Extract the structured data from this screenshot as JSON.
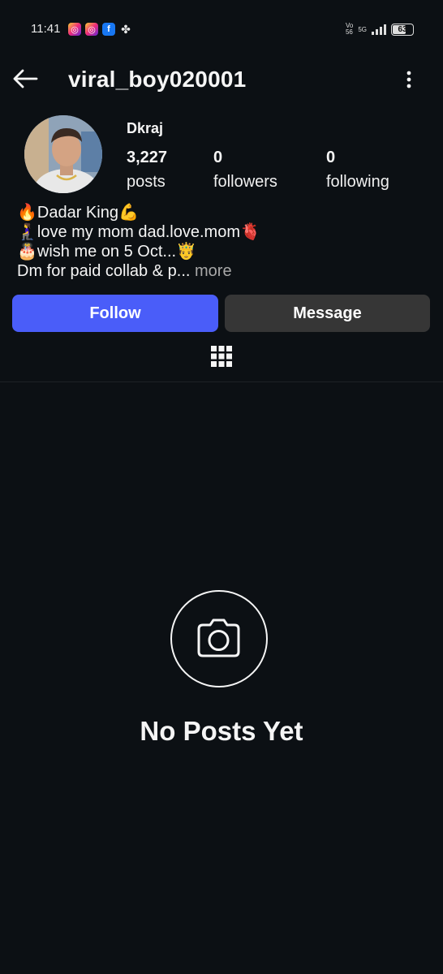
{
  "status_bar": {
    "time": "11:41",
    "volte_top": "Vo",
    "volte_bottom": "56",
    "network": "5G",
    "battery": "63"
  },
  "header": {
    "username": "viral_boy020001",
    "back_icon": "arrow-left-icon",
    "more_icon": "vertical-dots-icon"
  },
  "profile": {
    "display_name": "Dkraj",
    "stats": [
      {
        "value": "3,227",
        "label": "posts"
      },
      {
        "value": "0",
        "label": "followers"
      },
      {
        "value": "0",
        "label": "following"
      }
    ],
    "bio": [
      "🔥Dadar King💪",
      "🧎‍♀️love my mom dad.love.mom🫀",
      "🎂wish me on 5 Oct...🤴",
      "Dm for paid collab & p..."
    ],
    "bio_more": "more"
  },
  "actions": {
    "follow_label": "Follow",
    "message_label": "Message"
  },
  "empty_state": {
    "title": "No Posts Yet",
    "icon": "camera-icon"
  },
  "colors": {
    "background": "#0c1014",
    "follow_button": "#4a5df9",
    "message_button": "#363636"
  }
}
